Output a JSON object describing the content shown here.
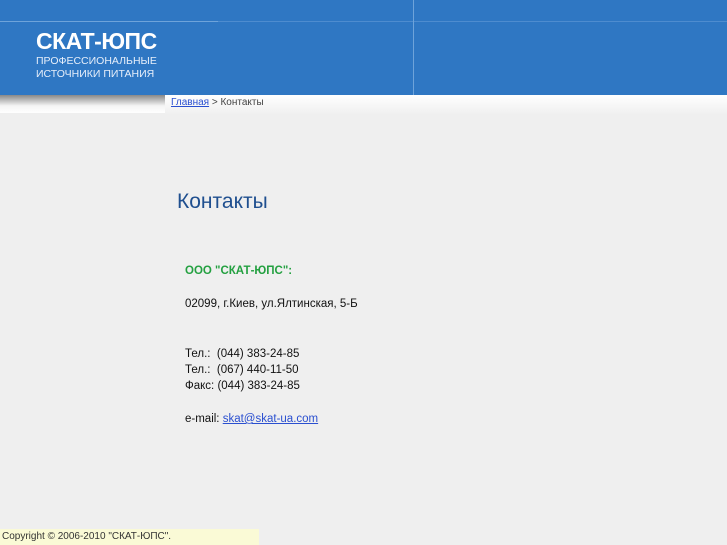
{
  "logo": {
    "title": "СКАТ-ЮПС",
    "line1": "ПРОФЕССИОНАЛЬНЫЕ",
    "line2": "ИСТОЧНИКИ ПИТАНИЯ"
  },
  "breadcrumb": {
    "home": "Главная",
    "sep": " > ",
    "current": "Контакты"
  },
  "page_title": "Контакты",
  "company": "ООО \"СКАТ-ЮПС\":",
  "address": "02099, г.Киев, ул.Ялтинская, 5-Б",
  "phones": [
    {
      "label": "Тел.:",
      "value": "(044) 383-24-85"
    },
    {
      "label": "Тел.:",
      "value": "(067) 440-11-50"
    },
    {
      "label": "Факс:",
      "value": "(044) 383-24-85"
    }
  ],
  "email": {
    "label": "e-mail:",
    "value": "skat@skat-ua.com"
  },
  "copyright": "Copyright © 2006-2010 \"СКАТ-ЮПС\"."
}
